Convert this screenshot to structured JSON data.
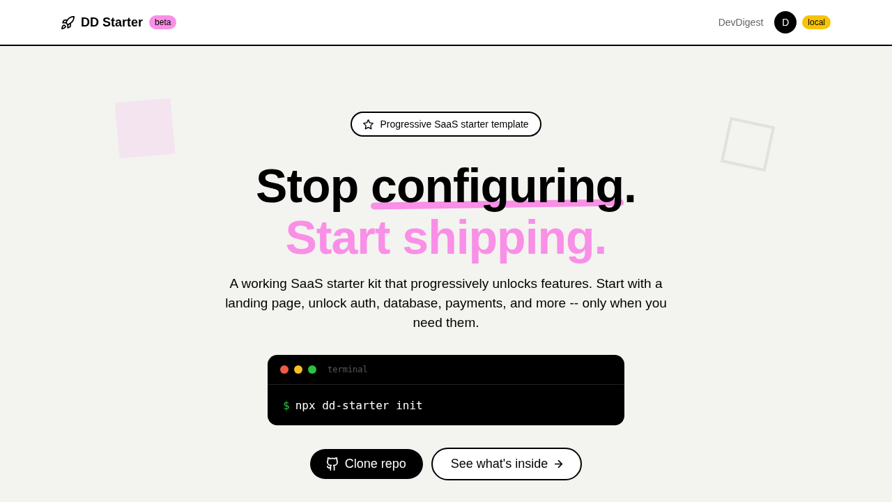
{
  "header": {
    "brand": {
      "name": "DD Starter",
      "badge": "beta"
    },
    "link": "DevDigest",
    "avatar": {
      "initial": "D"
    },
    "env_badge": "local"
  },
  "hero": {
    "pill": "Progressive SaaS starter template",
    "headline": {
      "before": "Stop ",
      "highlight": "configuring",
      "after": ".",
      "line_2": "Start shipping."
    },
    "description": "A working SaaS starter kit that progressively unlocks features. Start with a landing page, unlock auth, database, payments, and more -- only when you need them.",
    "terminal": {
      "title": "terminal",
      "prompt": "$",
      "command": "npx dd-starter init"
    },
    "buttons": [
      {
        "label": "Clone repo",
        "kind": "primary"
      },
      {
        "label": "See what's inside",
        "kind": "secondary"
      }
    ]
  }
}
